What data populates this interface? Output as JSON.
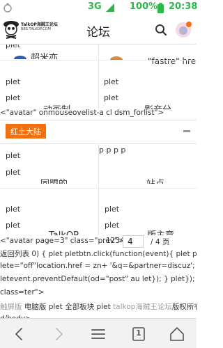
{
  "status_bar": {
    "network": "3G",
    "battery": "100%",
    "time": "20:38",
    "icons": [
      "notification-icon",
      "signal-icon",
      "battery-icon"
    ]
  },
  "header": {
    "logo_brand": "TalkOP海贼王论坛",
    "logo_url": "BBS.TALKOP.COM",
    "title": "论坛",
    "icons": [
      "search-icon",
      "user-avatar"
    ]
  },
  "content": {
    "grid_top": {
      "row1_left": "plet",
      "row1_left_name": "超米亦",
      "row1_right": "plet",
      "row1_right_name": "\"fastre\" hre",
      "row2_left_a": "plet",
      "row2_left_b": "plet",
      "row2_left_name": "动画制",
      "row2_right_a": "plet",
      "row2_right_b": "plet",
      "row2_right_name": "影音分"
    },
    "broken_markup_1": "<\"avatar\" onmouseovelist-a cl dsm_forlist\">",
    "section_name": "红土大陆",
    "grid_bottom": {
      "row1_left_a": "plet",
      "row1_left_b": "plet",
      "row1_left_name": "同盟的",
      "row1_right_a": "p p p p",
      "row1_right_name": "站点",
      "row2_left_a": "plet",
      "row2_left_b": "plet",
      "row2_left_name": "TalkOP",
      "row2_right_a": "plet",
      "row2_right_b": "plet",
      "row2_right_name": "版主竞"
    },
    "pagination": {
      "prefix": "<\"avatar page=3\" class=\"prev\">",
      "pages": "1234",
      "current": "4",
      "total": "/ 4 页"
    },
    "broken_markup_2": [
      "返回列表 0) { plet pletbtn.click(function(event){ plet plet",
      "lete=\"off\"location.href = zn+ '&q=&partner=discuz'; plet plet",
      "letevent.preventDefault(od=\"post\" au let}); } plet}); } div",
      "class=ter\">"
    ],
    "footer": {
      "dim_1": "触屏版",
      "link_1": "电脑版",
      "plain_1": "plet",
      "link_2": "全部板块",
      "plain_2": "plet",
      "dim_2": "talkop海贼王论坛",
      "plain_3": "版权所有",
      "tail": "d/body>"
    }
  },
  "bottom_nav": {
    "tab_count": "1",
    "items": [
      "back-icon",
      "forward-icon",
      "menu-icon",
      "tabs-icon",
      "home-icon"
    ]
  },
  "colors": {
    "accent_orange": "#f2700f",
    "status_green": "#30b54a",
    "header_border": "#e3e3e3"
  }
}
